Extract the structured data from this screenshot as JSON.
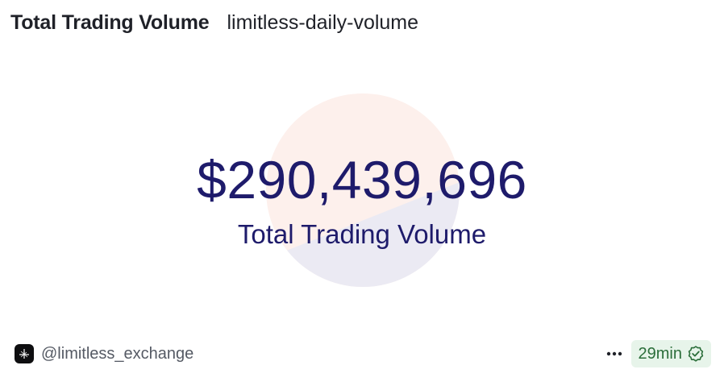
{
  "header": {
    "title": "Total Trading Volume",
    "query_name": "limitless-daily-volume"
  },
  "counter": {
    "value": "$290,439,696",
    "label": "Total Trading Volume"
  },
  "footer": {
    "author_handle": "@limitless_exchange",
    "freshness": "29min"
  },
  "icons": {
    "avatar": "limitless-logo-icon",
    "more": "more-horizontal-icon",
    "verified": "check-badge-icon"
  },
  "colors": {
    "value_text": "#1e1b6b",
    "watermark_top": "#fdf0ec",
    "watermark_bottom": "#ebeaf3",
    "badge_bg": "#e7f4ea",
    "badge_text": "#2b6e3a"
  }
}
